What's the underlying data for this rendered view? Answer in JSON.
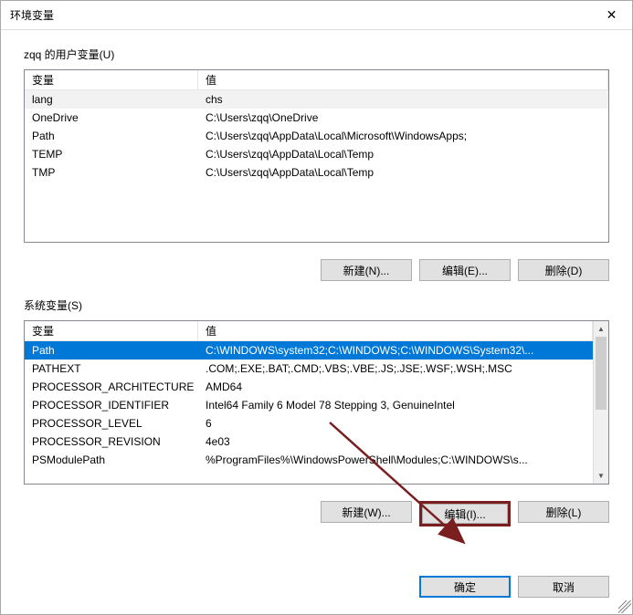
{
  "window": {
    "title": "环境变量",
    "close_glyph": "✕"
  },
  "user_section": {
    "label": "zqq 的用户变量(U)",
    "headers": {
      "var": "变量",
      "val": "值"
    },
    "rows": [
      {
        "var": "lang",
        "val": "chs",
        "hl": "light"
      },
      {
        "var": "OneDrive",
        "val": "C:\\Users\\zqq\\OneDrive"
      },
      {
        "var": "Path",
        "val": "C:\\Users\\zqq\\AppData\\Local\\Microsoft\\WindowsApps;"
      },
      {
        "var": "TEMP",
        "val": "C:\\Users\\zqq\\AppData\\Local\\Temp"
      },
      {
        "var": "TMP",
        "val": "C:\\Users\\zqq\\AppData\\Local\\Temp"
      }
    ],
    "buttons": {
      "new": "新建(N)...",
      "edit": "编辑(E)...",
      "del": "删除(D)"
    }
  },
  "system_section": {
    "label": "系统变量(S)",
    "headers": {
      "var": "变量",
      "val": "值"
    },
    "rows": [
      {
        "var": "Path",
        "val": "C:\\WINDOWS\\system32;C:\\WINDOWS;C:\\WINDOWS\\System32\\...",
        "hl": "sel"
      },
      {
        "var": "PATHEXT",
        "val": ".COM;.EXE;.BAT;.CMD;.VBS;.VBE;.JS;.JSE;.WSF;.WSH;.MSC"
      },
      {
        "var": "PROCESSOR_ARCHITECTURE",
        "val": "AMD64"
      },
      {
        "var": "PROCESSOR_IDENTIFIER",
        "val": "Intel64 Family 6 Model 78 Stepping 3, GenuineIntel"
      },
      {
        "var": "PROCESSOR_LEVEL",
        "val": "6"
      },
      {
        "var": "PROCESSOR_REVISION",
        "val": "4e03"
      },
      {
        "var": "PSModulePath",
        "val": "%ProgramFiles%\\WindowsPowerShell\\Modules;C:\\WINDOWS\\s..."
      }
    ],
    "buttons": {
      "new": "新建(W)...",
      "edit": "编辑(I)...",
      "del": "删除(L)"
    }
  },
  "footer_buttons": {
    "ok": "确定",
    "cancel": "取消"
  },
  "scrollbar": {
    "up": "▲",
    "down": "▼"
  }
}
